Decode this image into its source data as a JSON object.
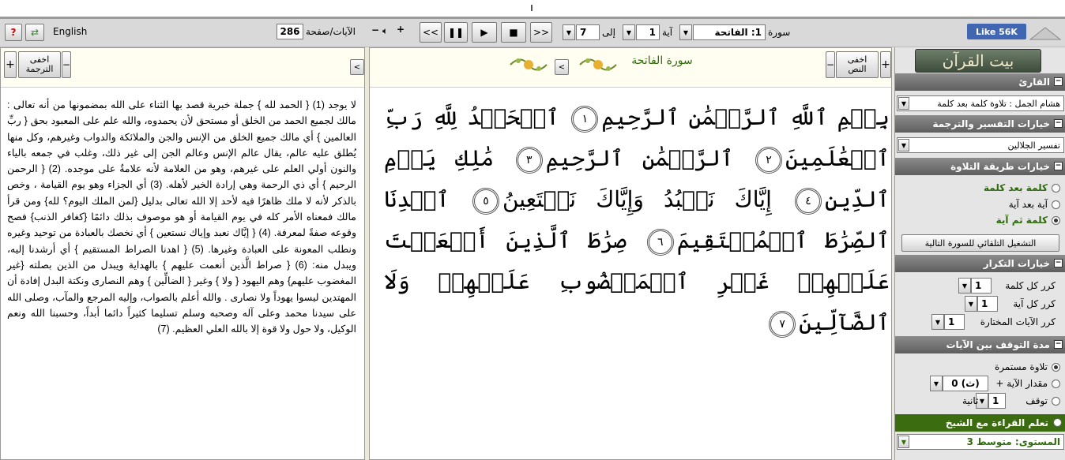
{
  "toolbar": {
    "language": "English",
    "per_page_label": "الآيات/صفحة",
    "per_page_value": "286",
    "next_label": ">>",
    "prev_label": "<<",
    "verse_to": "7",
    "to_label": "إلى",
    "verse_from": "1",
    "verse_label": "آية",
    "surah_value": "1: الفاتحة",
    "surah_label": "سورة",
    "like_label": "Like 56K",
    "help_label": "?"
  },
  "quran_panel": {
    "title": "سورة الفاتحة",
    "hide_label": "اخفى\nالنص",
    "text_segments": [
      "بِسۡمِ ٱللَّهِ ٱلرَّحۡمَٰنِ ٱلرَّحِيمِ",
      "ٱلۡحَمۡدُ لِلَّهِ رَبِّ ٱلۡعَٰلَمِينَ",
      "ٱلرَّحۡمَٰنِ ٱلرَّحِيمِ",
      "مَٰلِكِ يَوۡمِ ٱلدِّينِ",
      "إِيَّاكَ نَعۡبُدُ وَإِيَّاكَ نَسۡتَعِينُ",
      "ٱهۡدِنَا ٱلصِّرَٰطَ ٱلۡمُسۡتَقِيمَ",
      "صِرَٰطَ ٱلَّذِينَ أَنۡعَمۡتَ عَلَيۡهِمۡ غَيۡرِ ٱلۡمَغۡضُوبِ عَلَيۡهِمۡ وَلَا ٱلضَّآلِّينَ"
    ],
    "ayah_numbers": [
      "١",
      "٢",
      "٣",
      "٤",
      "٥",
      "٦",
      "٧"
    ]
  },
  "translation_panel": {
    "hide_label": "اخفى\nالترجمة",
    "text": "لا يوجد (1) { الحمد لله } جملة خبرية قصد بها الثناء على الله بمضمونها من أنه تعالى : مالك لجميع الحمد من الخلق أو مستحق لأن يحمدوه، والله علم على المعبود بحق { ربِّ العالمين } أي مالك جميع الخلق من الإنس والجن والملائكة والدواب وغيرهم، وكل منها يُطلق عليه عالم، يقال عالم الإنس وعالم الجن إلى غير ذلك، وغلب في جمعه بالياء والنون أولي العلم على غيرهم، وهو من العلامة لأنه علامةٌ على موجده. (2) { الرحمن الرحيم } أي ذي الرحمة وهي إرادة الخير لأهله. (3) أي الجزاء وهو يوم القيامة ، وخص بالذكر لأنه لا ملك ظاهرًا فيه لأحد إلا الله تعالى بدليل {لمن الملك اليوم؟ لله} ومن قرأ مالك فمعناه الأمر كله في يوم القيامة أو هو موصوف بذلك دائمًا {كغافر الذنب} فصح وقوعه صفةً لمعرفة. (4) { إيَّاك نعبد وإياك نستعين } أي نخصك بالعبادة من توحيد وغيره ونطلب المعونة على العبادة وغيرها. (5) { اهدنا الصراط المستقيم } أي أرشدنا إليه، ويبدل منه: (6) { صراط الَّذين أنعمت عليهم } بالهداية ويبدل من الذين بصلته {غير المغضوب عليهم} وهم اليهود { ولا } وغير { الضالِّين } وهم النصارى ونكتة البدل إفادة أن المهتدين ليسوا يهوداً ولا نصارى . والله أعلم بالصواب، وإليه المرجع والمآب، وصلى الله على سيدنا محمد وعلى آله وصحبه وسلم تسليما كثيراً دائما أبداً، وحسبنا الله ونعم الوكيل، ولا حول ولا قوة إلا بالله العلي العظيم. (7)"
  },
  "sidebar": {
    "logo": "بيت القرآن",
    "reciter_header": "القارئ",
    "reciter_value": "هشام الجمل : تلاوة كلمة بعد كلمة",
    "tafsir_header": "خيارات التفسير والترجمة",
    "tafsir_value": "تفسير الجلالين",
    "method_header": "خيارات طريقة التلاوة",
    "method_options": [
      "كلمة بعد كلمة",
      "آية بعد آية",
      "كلمة ثم آية"
    ],
    "auto_next": "التشغيل التلقائي للسورة التالية",
    "repeat_header": "خيارات التكرار",
    "repeat_word": "كرر كل كلمة",
    "repeat_word_val": "1",
    "repeat_ayah": "كرر كل آية",
    "repeat_ayah_val": "1",
    "repeat_sel": "كرر الآيات المختارة",
    "repeat_sel_val": "1",
    "pause_header": "مدة التوقف بين الآيات",
    "pause_opts": [
      "تلاوة مستمرة",
      "مقدار الآية +",
      "توقف"
    ],
    "pause_val1": "0 (ث)",
    "pause_val2": "1",
    "pause_unit": "ثانية",
    "learn_header": "تعلم القراءة مع الشيخ",
    "level_label": "المستوى:",
    "level_value": "متوسط 3"
  },
  "colors": {
    "accent_green": "#2e6b0c",
    "learn_bg": "#3b6d10",
    "fb_blue": "#4267b2"
  }
}
